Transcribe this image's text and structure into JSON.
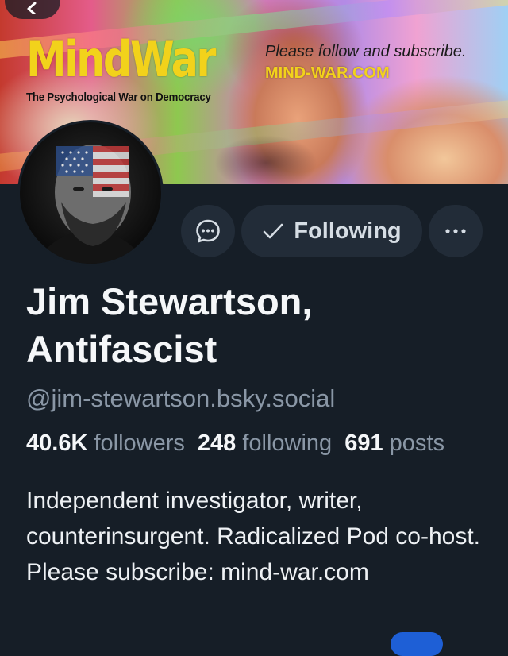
{
  "banner": {
    "logo_title": "MindWar",
    "logo_tagline": "The Psychological War on Democracy",
    "promo_line1": "Please follow and subscribe.",
    "promo_line2": "MIND-WAR.COM"
  },
  "nav": {
    "back_icon": "chevron-left-icon"
  },
  "actions": {
    "message_icon": "chat-bubble-icon",
    "follow_label": "Following",
    "follow_icon": "checkmark-icon",
    "more_icon": "ellipsis-icon"
  },
  "profile": {
    "display_name": "Jim Stewartson, Antifascist",
    "handle": "@jim-stewartson.bsky.social",
    "stats": {
      "followers_count": "40.6K",
      "followers_label": "followers",
      "following_count": "248",
      "following_label": "following",
      "posts_count": "691",
      "posts_label": "posts"
    },
    "bio": "Independent investigator, writer, counterinsurgent. Radicalized Pod co-host. Please subscribe: mind-war.com"
  },
  "colors": {
    "background": "#161e27",
    "button_bg": "#222c38",
    "muted_text": "#8a97a6",
    "logo_yellow": "#f2d21b"
  }
}
